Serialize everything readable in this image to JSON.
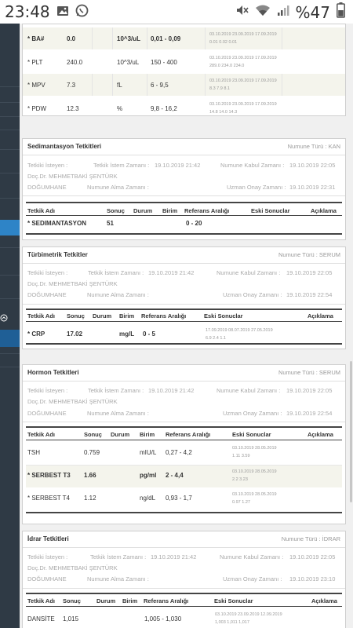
{
  "status": {
    "time": "23:48",
    "battery": "%47"
  },
  "top_rows": [
    {
      "name": "* BA#",
      "result": "0.0",
      "unit": "10^3/uL",
      "range": "0,01 - 0,09",
      "dates": "03.10.2019  23.09.2019  17.09.2019",
      "values": "0.01        0.02        0.01"
    },
    {
      "name": "* PLT",
      "result": "240.0",
      "unit": "10^3/uL",
      "range": "150 - 400",
      "dates": "03.10.2019  23.09.2019  17.09.2019",
      "values": "289.0       234.0       234.0"
    },
    {
      "name": "* MPV",
      "result": "7.3",
      "unit": "fL",
      "range": "6 - 9,5",
      "dates": "03.10.2019  23.09.2019  17.09.2019",
      "values": "8.3          7.9          8.1"
    },
    {
      "name": "* PDW",
      "result": "12.3",
      "unit": "%",
      "range": "9,8 - 16,2",
      "dates": "03.10.2019  23.09.2019  17.09.2019",
      "values": "14.8        14.0        14.3"
    }
  ],
  "sed": {
    "title": "Sedimantasyon Tetkitleri",
    "type": "Numune Türü : KAN",
    "requester": "Tetkiki İsteyen :",
    "req_time_label": "Tetkik İstem Zamanı :",
    "req_time": "19.10.2019 21:42",
    "accept_label": "Numune Kabul Zamanı :",
    "accept_time": "19.10.2019 22:05",
    "doctor": "Doç.Dr. MEHMETBAKİ ŞENTÜRK",
    "dept": "DOĞUMHANE",
    "sample_label": "Numune Alma Zamanı :",
    "approve_label": "Uzman Onay Zamanı :",
    "approve_time": "19.10.2019 22:31",
    "headers": [
      "Tetkik Adı",
      "Sonuç",
      "Durum",
      "Birim",
      "Referans Aralığı",
      "Eski Sonuclar",
      "Açıklama"
    ],
    "row": {
      "name": "* SEDIMANTASYON",
      "result": "51",
      "range": "0 - 20"
    }
  },
  "turb": {
    "title": "Türbimetrik Tetkitler",
    "type": "Numune Türü : SERUM",
    "requester": "Tetkiki İsteyen :",
    "req_time_label": "Tetkik İstem Zamanı :",
    "req_time": "19.10.2019 21:42",
    "accept_label": "Numune Kabul Zamanı :",
    "accept_time": "19.10.2019 22:05",
    "doctor": "Doç.Dr. MEHMETBAKİ ŞENTÜRK",
    "dept": "DOĞUMHANE",
    "sample_label": "Numune Alma Zamanı :",
    "approve_label": "Uzman Onay Zamanı :",
    "approve_time": "19.10.2019 22:54",
    "headers": [
      "Tetkik Adı",
      "Sonuç",
      "Durum",
      "Birim",
      "Referans Aralığı",
      "Eski Sonuclar",
      "Açıklama"
    ],
    "row": {
      "name": "* CRP",
      "result": "17.02",
      "unit": "mg/L",
      "range": "0 - 5",
      "dates": "17.09.2019  08.07.2019  27.05.2019",
      "values": "6.9           2.4           1.1"
    }
  },
  "horm": {
    "title": "Hormon Tetkitleri",
    "type": "Numune Türü : SERUM",
    "requester": "Tetkiki İsteyen :",
    "req_time_label": "Tetkik İstem Zamanı :",
    "req_time": "19.10.2019 21:42",
    "accept_label": "Numune Kabul Zamanı :",
    "accept_time": "19.10.2019 22:05",
    "doctor": "Doç.Dr. MEHMETBAKİ ŞENTÜRK",
    "dept": "DOĞUMHANE",
    "sample_label": "Numune Alma Zamanı :",
    "approve_label": "Uzman Onay Zamanı :",
    "approve_time": "19.10.2019 22:54",
    "headers": [
      "Tetkik Adı",
      "Sonuç",
      "Durum",
      "Birim",
      "Referans Aralığı",
      "Eski Sonuclar",
      "Açıklama"
    ],
    "rows": [
      {
        "name": "TSH",
        "result": "0.759",
        "unit": "mIU/L",
        "range": "0,27 - 4,2",
        "dates": "03.10.2019  28.05.2019",
        "values": "1.11          3.59"
      },
      {
        "name": "* SERBEST T3",
        "result": "1.66",
        "unit": "pg/ml",
        "range": "2 - 4,4",
        "dates": "03.10.2019  28.05.2019",
        "values": "2.2            3.23"
      },
      {
        "name": "* SERBEST T4",
        "result": "1.12",
        "unit": "ng/dL",
        "range": "0,93 - 1,7",
        "dates": "03.10.2019  28.05.2019",
        "values": "0.97          1.27"
      }
    ]
  },
  "idrar": {
    "title": "İdrar Tetkitleri",
    "type": "Numune Türü : İDRAR",
    "requester": "Tetkiki İsteyen :",
    "req_time_label": "Tetkik İstem Zamanı :",
    "req_time": "19.10.2019 21:42",
    "accept_label": "Numune Kabul Zamanı :",
    "accept_time": "19.10.2019 22:05",
    "doctor": "Doç.Dr. MEHMETBAKİ ŞENTÜRK",
    "dept": "DOĞUMHANE",
    "sample_label": "Numune Alma Zamanı :",
    "approve_label": "Uzman Onay Zamanı :",
    "approve_time": "19.10.2019 23:10",
    "headers": [
      "Tetkik Adı",
      "Sonuç",
      "Durum",
      "Birim",
      "Referans Aralığı",
      "Eski Sonuclar",
      "Açıklama"
    ],
    "row": {
      "name": "DANSİTE",
      "result": "1,015",
      "range": "1,005 - 1,030",
      "dates": "03.10.2019  23.09.2019  12.09.2019",
      "values": "1,003        1,011        1,017"
    }
  }
}
